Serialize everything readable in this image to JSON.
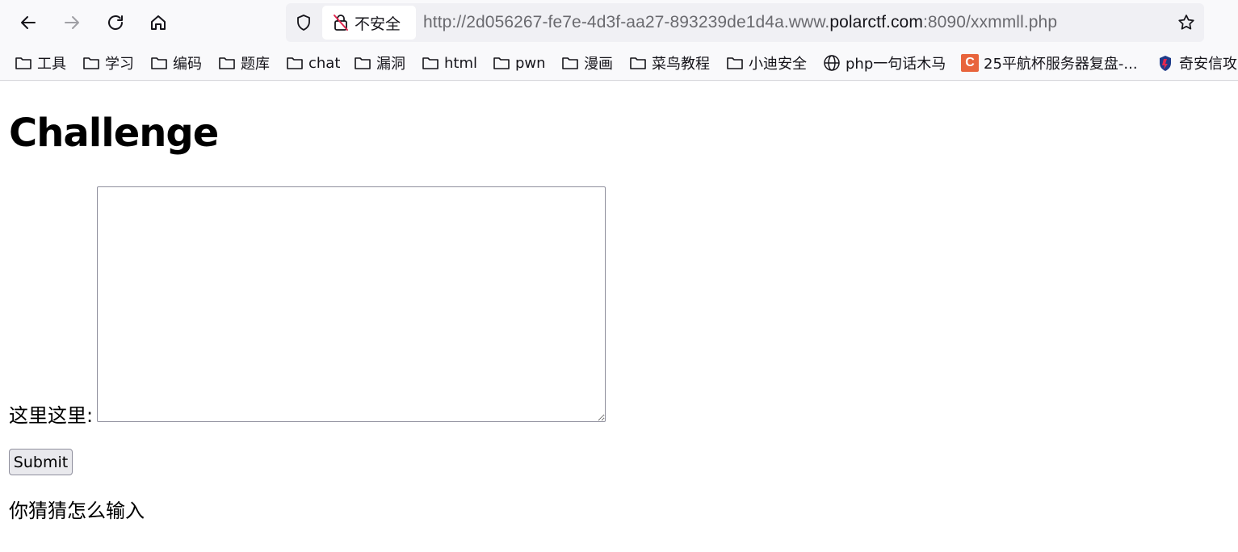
{
  "browser": {
    "security_label": "不安全",
    "url": {
      "prefix": "http://2d056267-fe7e-4d3f-aa27-893239de1d4a.www.",
      "host": "polarctf.com",
      "suffix": ":8090/xxmmll.php"
    },
    "bookmarks": [
      {
        "label": "工具",
        "icon": "folder-icon"
      },
      {
        "label": "学习",
        "icon": "folder-icon"
      },
      {
        "label": "编码",
        "icon": "folder-icon"
      },
      {
        "label": "题库",
        "icon": "folder-icon"
      },
      {
        "label": "chat",
        "icon": "folder-icon"
      },
      {
        "label": "漏洞",
        "icon": "folder-icon"
      },
      {
        "label": "html",
        "icon": "folder-icon"
      },
      {
        "label": "pwn",
        "icon": "folder-icon"
      },
      {
        "label": "漫画",
        "icon": "folder-icon"
      },
      {
        "label": "菜鸟教程",
        "icon": "folder-icon"
      },
      {
        "label": "小迪安全",
        "icon": "folder-icon"
      },
      {
        "label": "php一句话木马",
        "icon": "globe-icon"
      },
      {
        "label": "25平航杯服务器复盘-...",
        "icon": "c-logo-icon",
        "icon_text": "C"
      },
      {
        "label": "奇安信攻",
        "icon": "shield-logo-icon"
      }
    ]
  },
  "page": {
    "title": "Challenge",
    "field_label": "这里这里:",
    "textarea_value": "",
    "submit_label": "Submit",
    "hint": "你猜猜怎么输入"
  },
  "colors": {
    "chrome_bg": "#f9f9fb",
    "urlbar_bg": "#f0f0f4",
    "insecure_icon": "#e22850",
    "c_logo": "#e8643c"
  }
}
